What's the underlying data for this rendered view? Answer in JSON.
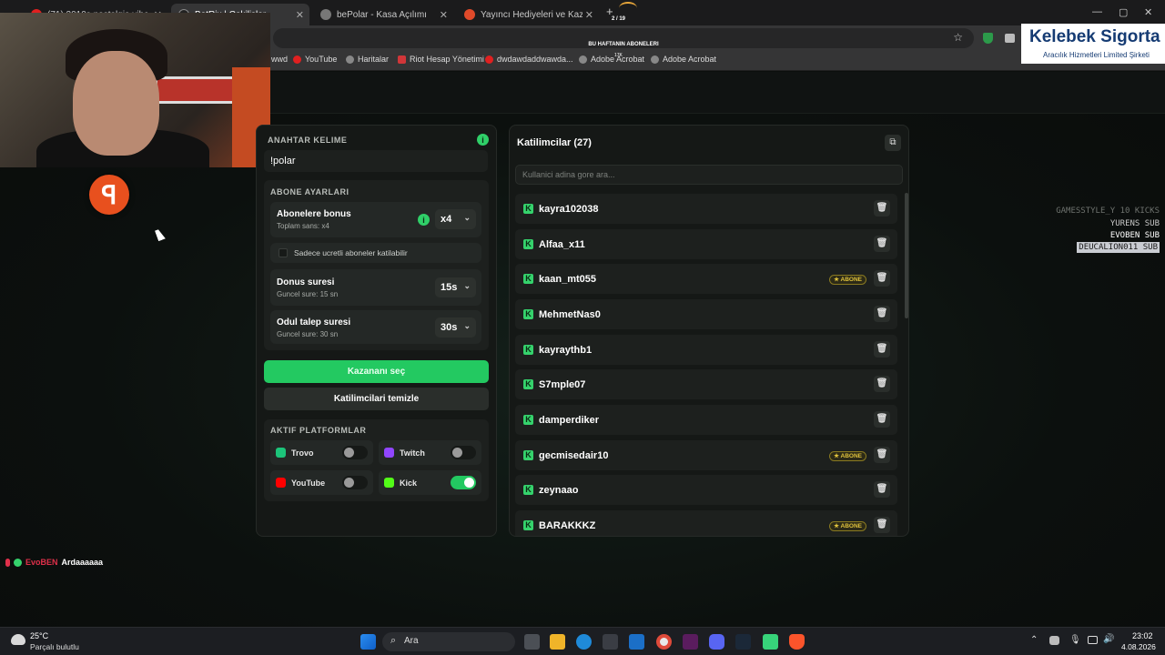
{
  "browser": {
    "tabs": [
      {
        "title": "(71) 2010s nostalgia vibes"
      },
      {
        "title": "BotRix | Cekilisler"
      },
      {
        "title": "bePolar - Kasa Açılımı"
      },
      {
        "title": "Yayıncı Hediyeleri ve Kazananlar"
      }
    ],
    "new_tab": "+",
    "bookmarks": [
      "wwd",
      "YouTube",
      "Haritalar",
      "Riot Hesap Yönetimi",
      "dwdawdaddwawda...",
      "Adobe Acrobat",
      "Adobe Acrobat"
    ]
  },
  "overlay": {
    "subs_title": "BU HAFTANIN ABONELERI",
    "subs_counter": "2 / 19",
    "subs_small": "17K",
    "sponsor_name": "Kelebek Sigorta",
    "sponsor_sub": "Aracılık Hizmetleri Limited Şirketi",
    "side_list": [
      "GAMESSTYLE_Y 10 KICKS",
      "YURENS SUB",
      "EVOBEN SUB",
      "DEUCALION011 SUB"
    ],
    "chat_user": "EvoBEN",
    "chat_msg": "Ardaaaaaa"
  },
  "left": {
    "keyword_label": "ANAHTAR KELIME",
    "keyword_value": "!polar",
    "sub_settings_label": "ABONE AYARLARI",
    "bonus_title": "Abonelere bonus",
    "bonus_sub": "Toplam sans: x4",
    "bonus_value": "x4",
    "paid_only": "Sadece ucretli aboneler katilabilir",
    "round_title": "Donus suresi",
    "round_sub": "Guncel sure: 15 sn",
    "round_value": "15s",
    "claim_title": "Odul talep suresi",
    "claim_sub": "Guncel sure: 30 sn",
    "claim_value": "30s",
    "pick_winner": "Kazananı seç",
    "clear_participants": "Katilimcilari temizle",
    "platforms_label": "AKTIF PLATFORMLAR",
    "platforms": [
      {
        "name": "Trovo",
        "on": false,
        "color": "#1cc47a"
      },
      {
        "name": "Twitch",
        "on": false,
        "color": "#9146ff"
      },
      {
        "name": "YouTube",
        "on": false,
        "color": "#ff0000"
      },
      {
        "name": "Kick",
        "on": true,
        "color": "#53fc18"
      }
    ]
  },
  "right": {
    "title": "Katilimcilar (27)",
    "search_placeholder": "Kullanici adina gore ara...",
    "badge_label": "ABONE",
    "participants": [
      {
        "name": "kayra102038",
        "sub": false
      },
      {
        "name": "Alfaa_x11",
        "sub": false
      },
      {
        "name": "kaan_mt055",
        "sub": true
      },
      {
        "name": "MehmetNas0",
        "sub": false
      },
      {
        "name": "kayraythb1",
        "sub": false
      },
      {
        "name": "S7mple07",
        "sub": false
      },
      {
        "name": "damperdiker",
        "sub": false
      },
      {
        "name": "gecmisedair10",
        "sub": true
      },
      {
        "name": "zeynaao",
        "sub": false
      },
      {
        "name": "BARAKKKZ",
        "sub": true
      }
    ]
  },
  "taskbar": {
    "weather_temp": "25°C",
    "weather_desc": "Parçalı bulutlu",
    "search": "Ara",
    "time": "23:02",
    "date": "4.08.2026"
  }
}
